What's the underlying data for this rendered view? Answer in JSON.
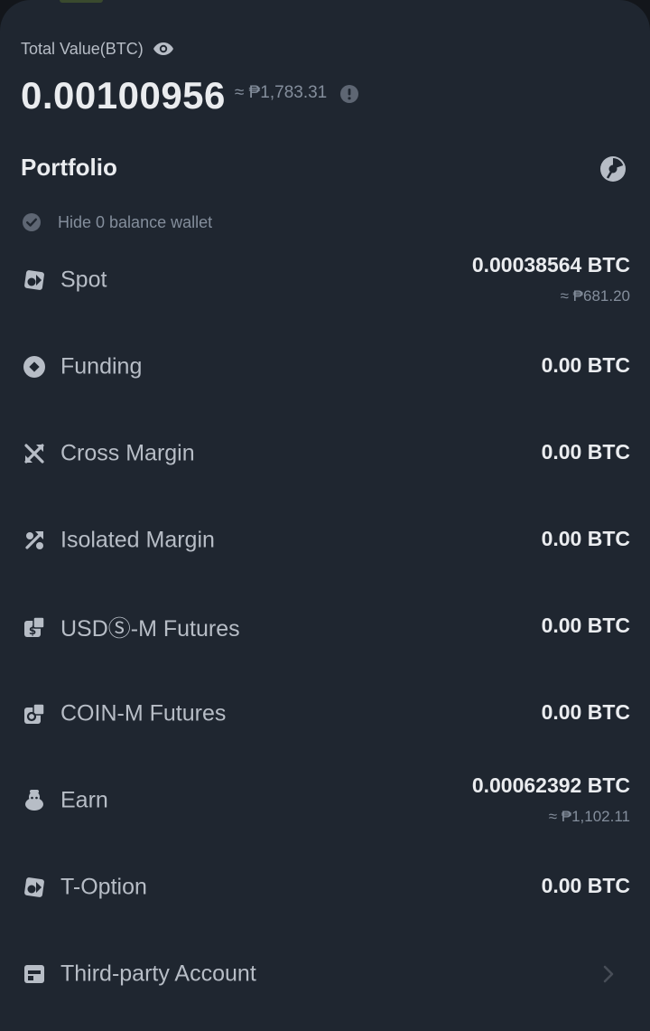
{
  "header": {
    "total_label": "Total Value(BTC)",
    "total_value": "0.00100956",
    "total_fiat": "≈ ₱1,783.31"
  },
  "portfolio": {
    "title": "Portfolio",
    "hide_zero_label": "Hide 0 balance wallet",
    "hide_zero_checked": true
  },
  "wallets": [
    {
      "name": "Spot",
      "amount": "0.00038564 BTC",
      "fiat": "≈ ₱681.20",
      "icon": "spot-icon"
    },
    {
      "name": "Funding",
      "amount": "0.00 BTC",
      "fiat": "",
      "icon": "funding-icon"
    },
    {
      "name": "Cross Margin",
      "amount": "0.00 BTC",
      "fiat": "",
      "icon": "cross-margin-icon"
    },
    {
      "name": "Isolated Margin",
      "amount": "0.00 BTC",
      "fiat": "",
      "icon": "isolated-margin-icon"
    },
    {
      "name": "USDⓈ-M Futures",
      "amount": "0.00 BTC",
      "fiat": "",
      "icon": "usds-m-futures-icon"
    },
    {
      "name": "COIN-M Futures",
      "amount": "0.00 BTC",
      "fiat": "",
      "icon": "coin-m-futures-icon"
    },
    {
      "name": "Earn",
      "amount": "0.00062392 BTC",
      "fiat": "≈ ₱1,102.11",
      "icon": "earn-icon"
    },
    {
      "name": "T-Option",
      "amount": "0.00 BTC",
      "fiat": "",
      "icon": "t-option-icon"
    },
    {
      "name": "Third-party Account",
      "amount": "",
      "fiat": "",
      "icon": "third-party-account-icon"
    }
  ],
  "colors": {
    "background": "#1f2630",
    "text_primary": "#eaecef",
    "text_secondary": "#848e9c",
    "icon": "#b7bdc6"
  }
}
